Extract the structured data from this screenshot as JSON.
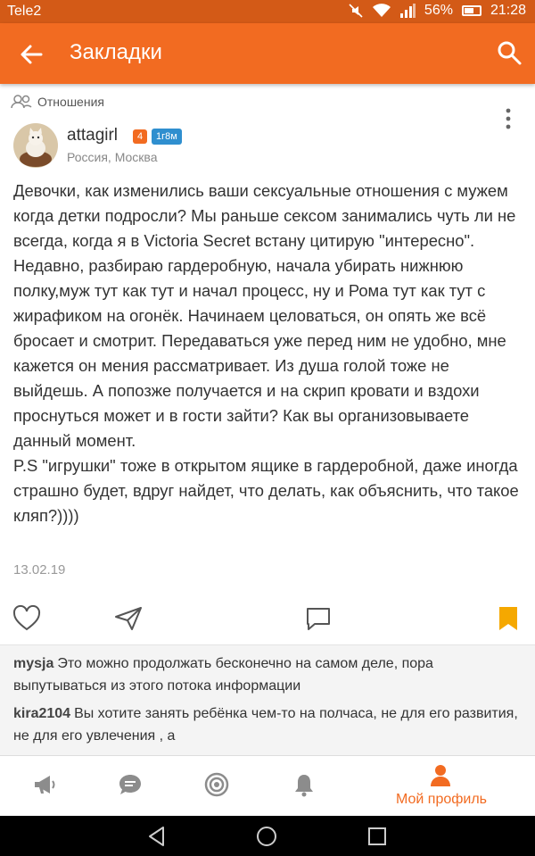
{
  "status_bar": {
    "carrier": "Tele2",
    "battery": "56%",
    "time": "21:28"
  },
  "app_bar": {
    "title": "Закладки"
  },
  "post": {
    "category": "Отношения",
    "author": {
      "name": "attagirl",
      "level": "4",
      "membership": "1г8м",
      "location": "Россия, Москва"
    },
    "text": "Девочки, как изменились ваши сексуальные отношения с мужем когда детки подросли? Мы раньше сексом занимались чуть ли не всегда, когда я в Victoria Secret встану цитирую \"интересно\". Недавно, разбираю гардеробную, начала убирать нижнюю полку,муж тут как тут и начал процесс, ну и Рома тут как тут с жирафиком на огонёк. Начинаем целоваться, он опять же всё бросает и смотрит. Передаваться уже перед ним не удобно, мне кажется он мения рассматривает. Из душа голой тоже не выйдешь. А попозже получается и на скрип кровати и вздохи проснуться может и в гости зайти? Как вы организовываете данный момент.\nP.S \"игрушки\" тоже в открытом ящике в гардеробной, даже иногда страшно будет, вдруг найдет, что делать, как объяснить, что такое кляп?))))",
    "date": "13.02.19"
  },
  "comments": [
    {
      "author": "mysja",
      "text": "Это можно продолжать бесконечно на самом деле, пора выпутываться из этого потока информации"
    },
    {
      "author": "kira2104",
      "text": "Вы хотите занять ребёнка чем-то на полчаса, не для его развития, не для его увлечения , а"
    }
  ],
  "bottom_nav": {
    "active_label": "Мой профиль"
  },
  "colors": {
    "accent": "#f26b21",
    "status_bar": "#d35a17",
    "badge_blue": "#2f8fcf"
  },
  "icons": [
    "back-arrow-icon",
    "search-icon",
    "people-icon",
    "kebab-menu-icon",
    "heart-icon",
    "comment-icon",
    "share-icon",
    "bookmark-icon",
    "megaphone-icon",
    "chat-icon",
    "target-icon",
    "bell-icon",
    "profile-icon"
  ]
}
